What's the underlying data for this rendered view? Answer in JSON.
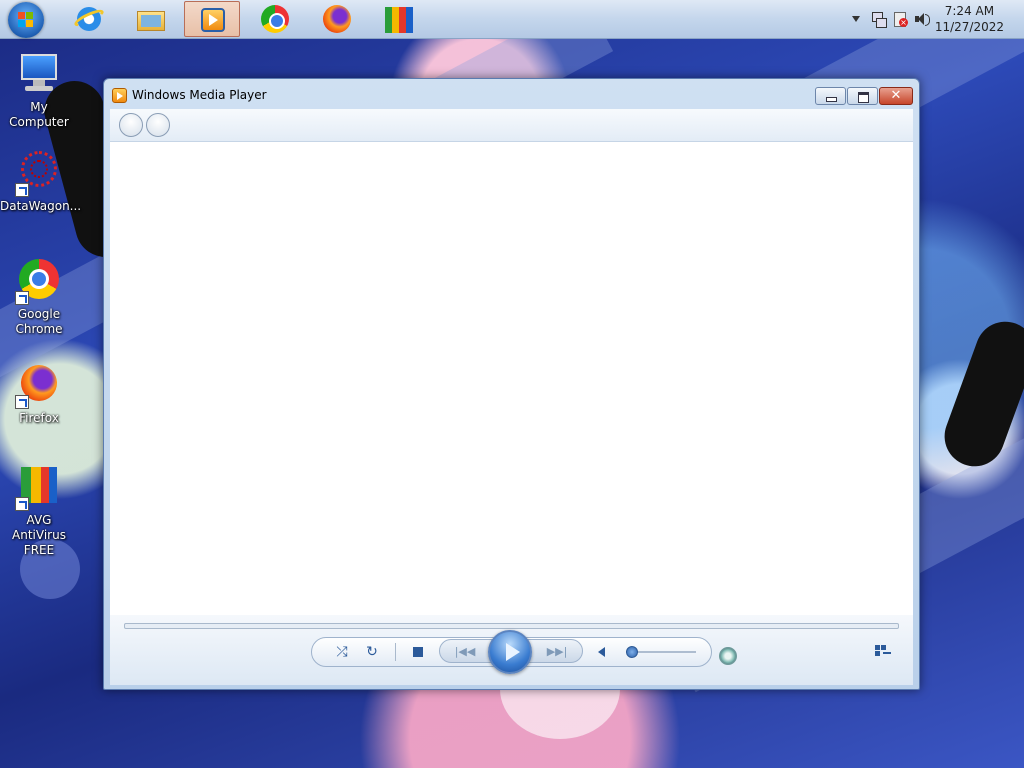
{
  "taskbar": {
    "start_icon": "windows-start-icon",
    "pinned": [
      {
        "name": "internet-explorer-icon",
        "active": false
      },
      {
        "name": "file-explorer-icon",
        "active": false
      },
      {
        "name": "windows-media-player-icon",
        "active": true
      },
      {
        "name": "chrome-icon",
        "active": false
      },
      {
        "name": "firefox-icon",
        "active": false
      },
      {
        "name": "avg-antivirus-icon",
        "active": false
      }
    ],
    "tray": {
      "time": "7:24 AM",
      "date": "11/27/2022",
      "icons": [
        "show-hidden-icons-chevron",
        "network-icon",
        "action-center-icon",
        "volume-icon"
      ]
    }
  },
  "desktop": {
    "icons": [
      {
        "label": "My Computer",
        "icon": "computer-icon"
      },
      {
        "label": "DataWagon...",
        "icon": "datawagon-icon"
      },
      {
        "label": "Google Chrome",
        "icon": "chrome-icon"
      },
      {
        "label": "Firefox",
        "icon": "firefox-icon"
      },
      {
        "label": "AVG AntiVirus FREE",
        "icon": "avg-icon"
      }
    ]
  },
  "window": {
    "title": "Windows Media Player",
    "controls": {
      "shuffle": "shuffle-icon",
      "repeat": "repeat-icon",
      "stop": "stop-icon",
      "previous": "previous-icon",
      "play": "play-icon",
      "next": "next-icon",
      "mute": "volume-icon",
      "switch_view": "switch-to-now-playing-icon"
    }
  }
}
